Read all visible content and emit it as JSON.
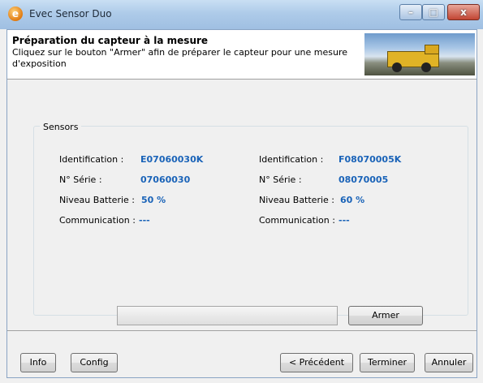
{
  "window": {
    "title": "Evec Sensor Duo",
    "app_icon_letter": "e",
    "controls": {
      "minimize": "–",
      "maximize": "□",
      "close": "x"
    }
  },
  "header": {
    "title": "Préparation du capteur à la mesure",
    "description": "Cliquez sur le bouton \"Armer\" afin de préparer le capteur pour une mesure d'exposition"
  },
  "sensors": {
    "group_label": "Sensors",
    "left": {
      "identification_label": "Identification :",
      "identification_value": "E07060030K",
      "serie_label": "N° Série :",
      "serie_value": "07060030",
      "battery_label": "Niveau Batterie :",
      "battery_value": "50 %",
      "communication_label": "Communication :",
      "communication_value": "---"
    },
    "right": {
      "identification_label": "Identification :",
      "identification_value": "F08070005K",
      "serie_label": "N° Série :",
      "serie_value": "08070005",
      "battery_label": "Niveau Batterie :",
      "battery_value": "60 %",
      "communication_label": "Communication :",
      "communication_value": "---"
    },
    "progress": 0,
    "arm_button": "Armer"
  },
  "footer": {
    "info_button": "Info",
    "config_button": "Config",
    "previous_button": "< Précédent",
    "finish_button": "Terminer",
    "cancel_button": "Annuler"
  },
  "colors": {
    "value_text": "#1a63b8",
    "titlebar": "#aecbe9"
  }
}
